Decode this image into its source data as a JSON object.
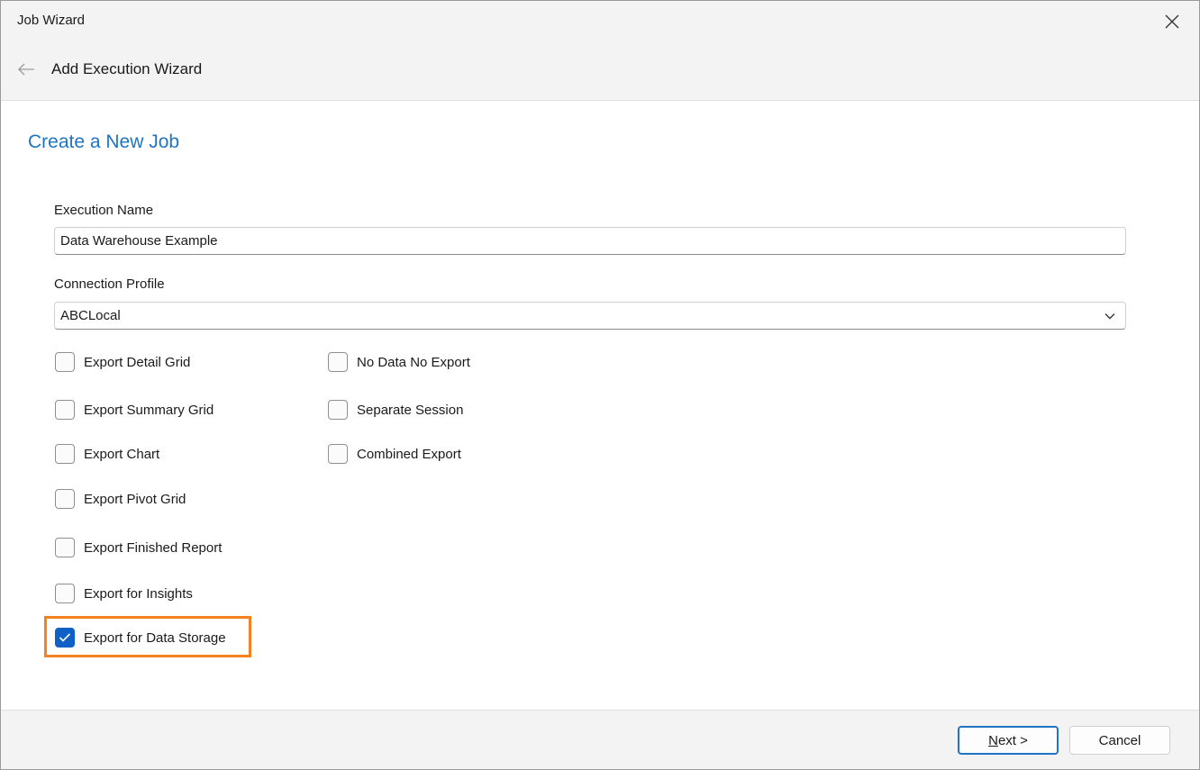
{
  "window": {
    "title": "Job Wizard"
  },
  "header": {
    "wizard_title": "Add Execution Wizard"
  },
  "page": {
    "heading": "Create a New Job"
  },
  "form": {
    "execution_name": {
      "label": "Execution Name",
      "value": "Data Warehouse Example"
    },
    "connection_profile": {
      "label": "Connection Profile",
      "selected": "ABCLocal"
    }
  },
  "options": {
    "export_detail_grid": {
      "label": "Export Detail Grid",
      "checked": false
    },
    "export_summary_grid": {
      "label": "Export Summary Grid",
      "checked": false
    },
    "export_chart": {
      "label": "Export Chart",
      "checked": false
    },
    "export_pivot_grid": {
      "label": "Export Pivot Grid",
      "checked": false
    },
    "export_finished_report": {
      "label": "Export Finished Report",
      "checked": false
    },
    "export_for_insights": {
      "label": "Export for Insights",
      "checked": false
    },
    "export_for_data_storage": {
      "label": "Export for Data Storage",
      "checked": true
    },
    "no_data_no_export": {
      "label": "No Data No Export",
      "checked": false
    },
    "separate_session": {
      "label": "Separate Session",
      "checked": false
    },
    "combined_export": {
      "label": "Combined Export",
      "checked": false
    }
  },
  "footer": {
    "next_mnemonic": "N",
    "next_rest": "ext >",
    "cancel_label": "Cancel"
  },
  "colors": {
    "accent": "#1f74c4",
    "checkbox_checked": "#0f61c7",
    "highlight": "#f5821f"
  }
}
